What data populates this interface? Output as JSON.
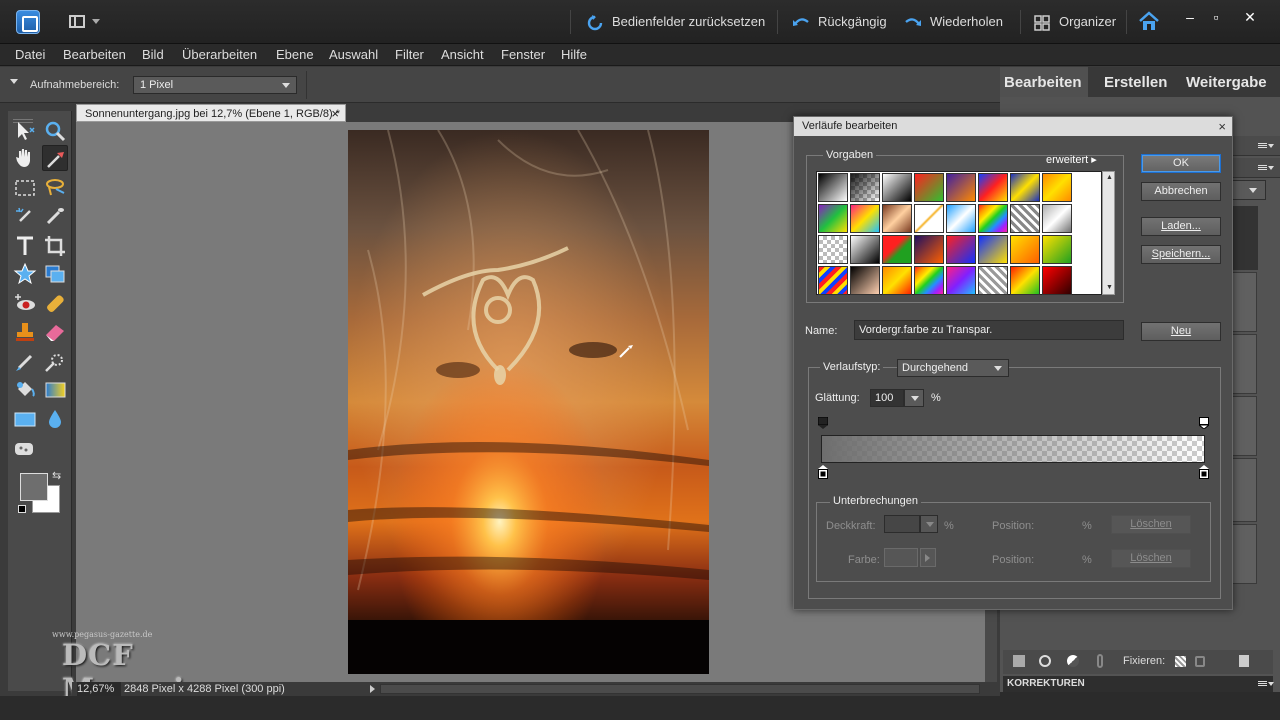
{
  "titlebar": {
    "reset_panels": "Bedienfelder zurücksetzen",
    "undo": "Rückgängig",
    "redo": "Wiederholen",
    "organizer": "Organizer"
  },
  "menu": [
    "Datei",
    "Bearbeiten",
    "Bild",
    "Überarbeiten",
    "Ebene",
    "Auswahl",
    "Filter",
    "Ansicht",
    "Fenster",
    "Hilfe"
  ],
  "options": {
    "label": "Aufnahmebereich:",
    "value": "1 Pixel"
  },
  "document": {
    "tab_title": "Sonnenuntergang.jpg bei 12,7% (Ebene 1, RGB/8) *",
    "zoom": "12,67%",
    "size": "2848 Pixel x 4288 Pixel (300 ppi)"
  },
  "watermark": {
    "small": "www.pegasus-gazette.de",
    "big": "DCF Magazin"
  },
  "right_panel": {
    "tabs": [
      "Bearbeiten",
      "Erstellen",
      "Weitergabe"
    ],
    "fix_label": "Fixieren:",
    "corrections": "KORREKTUREN"
  },
  "dialog": {
    "title": "Verläufe bearbeiten",
    "presets_label": "Vorgaben",
    "advanced": "erweitert",
    "ok": "OK",
    "cancel": "Abbrechen",
    "load": "Laden...",
    "save": "Speichern...",
    "name_label": "Name:",
    "name_value": "Vordergr.farbe zu Transpar.",
    "new": "Neu",
    "type_label": "Verlaufstyp:",
    "type_value": "Durchgehend",
    "smooth_label": "Glättung:",
    "smooth_value": "100",
    "smooth_unit": "%",
    "stops_label": "Unterbrechungen",
    "opacity_label": "Deckkraft:",
    "opacity_unit": "%",
    "position_label": "Position:",
    "position_unit": "%",
    "color_label": "Farbe:",
    "delete": "Löschen"
  },
  "colors": {
    "accent": "#1d6fd0",
    "foreground": "#6e6e6e",
    "background": "#ffffff"
  }
}
